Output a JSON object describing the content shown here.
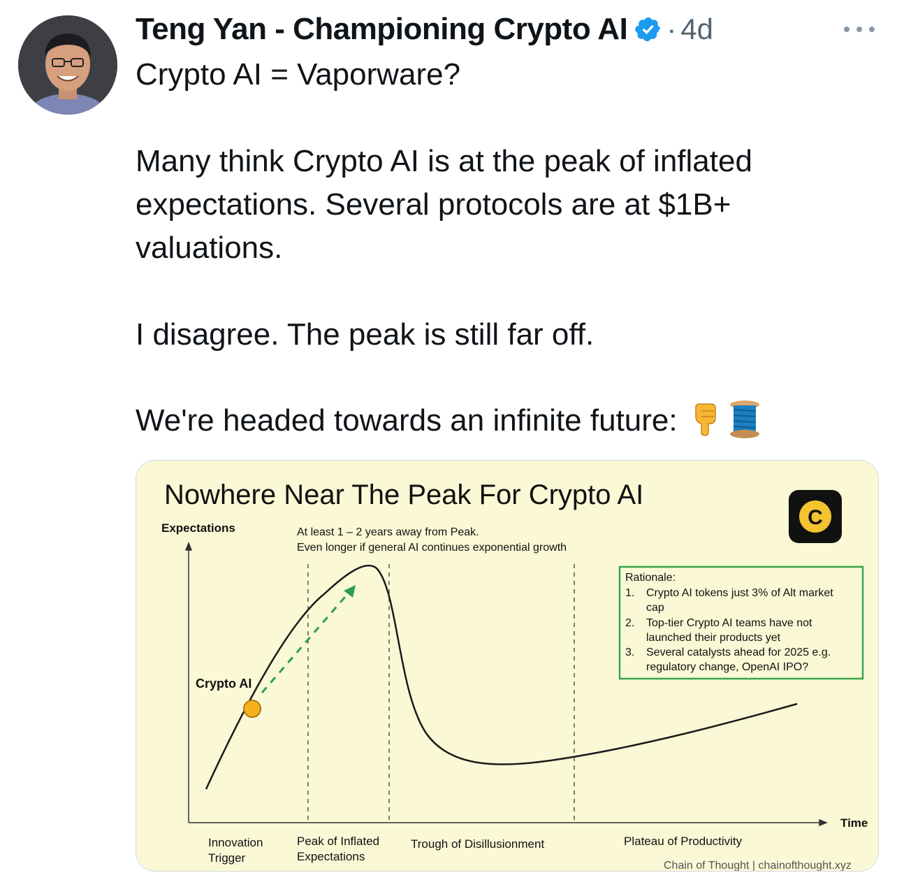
{
  "tweet": {
    "author_name": "Teng Yan - Championing Crypto AI",
    "separator": "·",
    "time": "4d",
    "lines": [
      "Crypto AI = Vaporware?",
      "Many think Crypto AI is at the peak of inflated expectations. Several protocols are at $1B+ valuations.",
      "I disagree. The peak is still far off.",
      "We're headed towards an infinite future:"
    ],
    "emojis": [
      "backhand-index-pointing-down-icon",
      "spool-of-thread-icon"
    ]
  },
  "chart_data": {
    "type": "line",
    "title": "Nowhere Near The Peak For Crypto AI",
    "ylabel": "Expectations",
    "xlabel": "Time",
    "annotation_top": [
      "At least 1 – 2 years away from Peak.",
      "Even longer if general AI continues exponential growth"
    ],
    "marker_label": "Crypto AI",
    "phases": [
      "Innovation Trigger",
      "Peak of Inflated Expectations",
      "Trough of Disillusionment",
      "Plateau of Productivity"
    ],
    "phase_labels_display": [
      [
        "Innovation",
        "Trigger"
      ],
      [
        "Peak of Inflated",
        "Expectations"
      ],
      [
        "Trough of Disillusionment"
      ],
      [
        "Plateau of Productivity"
      ]
    ],
    "rationale_title": "Rationale:",
    "rationale_items": [
      [
        "Crypto AI tokens just 3% of Alt market",
        "cap"
      ],
      [
        "Top-tier Crypto AI teams have not",
        "launched their products yet"
      ],
      [
        "Several catalysts ahead for 2025 e.g.",
        "regulatory change, OpenAI IPO?"
      ]
    ],
    "logo_letter": "C",
    "footer": "Chain of Thought | chainofthought.xyz",
    "colors": {
      "background": "#fbf8d6",
      "curve": "#1a1a1a",
      "arrow": "#2aa14a",
      "marker": "#f5b21d",
      "box_border": "#3aa34a"
    }
  },
  "colors": {
    "verified": "#1d9bf0",
    "meta": "#536471"
  }
}
